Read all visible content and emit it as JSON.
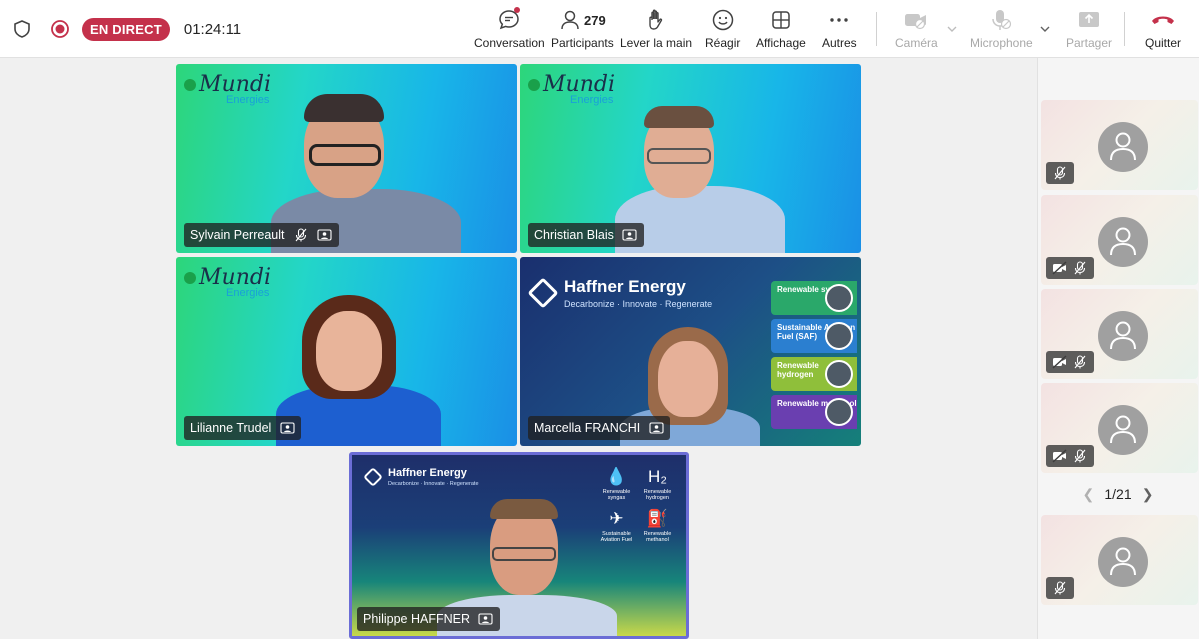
{
  "topbar": {
    "live_label": "EN DIRECT",
    "timer": "01:24:11",
    "buttons": {
      "conversation": "Conversation",
      "participants": "Participants",
      "participants_count": "279",
      "raise_hand": "Lever la main",
      "react": "Réagir",
      "view": "Affichage",
      "more": "Autres",
      "camera": "Caméra",
      "microphone": "Microphone",
      "share": "Partager",
      "leave": "Quitter"
    }
  },
  "brand": {
    "mundi_line1": "Mundi",
    "mundi_line2": "Energies",
    "haffner_title": "Haffner Energy",
    "haffner_sub": "Decarbonize · Innovate · Regenerate",
    "haffner_list": [
      {
        "label": "Renewable syngas",
        "color": "#2aa86a"
      },
      {
        "label": "Sustainable Aviation Fuel (SAF)",
        "color": "#2b7fd0"
      },
      {
        "label": "Renewable hydrogen",
        "color": "#8fbf3a"
      },
      {
        "label": "Renewable methanol",
        "color": "#6a3fb0"
      }
    ],
    "featured_items": [
      {
        "icon": "💧",
        "label": "Renewable syngas"
      },
      {
        "icon": "H₂",
        "label": "Renewable hydrogen"
      },
      {
        "icon": "✈",
        "label": "Sustainable Aviation Fuel"
      },
      {
        "icon": "⛽",
        "label": "Renewable methanol"
      }
    ]
  },
  "participants": {
    "p1": "Sylvain Perreault",
    "p2": "Christian Blais",
    "p3": "Lilianne Trudel",
    "p4": "Marcella FRANCHI",
    "p5": "Philippe HAFFNER"
  },
  "pager": {
    "text": "1/21"
  },
  "colors": {
    "live": "#c4314b",
    "leave": "#c4314b",
    "featured_border": "#6b6dd6"
  }
}
